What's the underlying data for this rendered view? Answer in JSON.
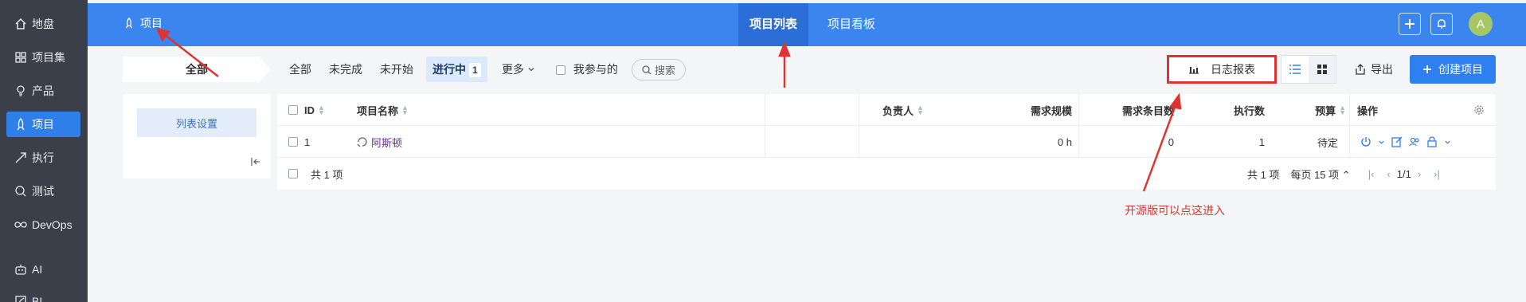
{
  "sidebar": {
    "items": [
      {
        "label": "地盘",
        "icon": "home-icon"
      },
      {
        "label": "项目集",
        "icon": "grid-icon"
      },
      {
        "label": "产品",
        "icon": "lightbulb-icon"
      },
      {
        "label": "项目",
        "icon": "rocket-icon",
        "active": true
      },
      {
        "label": "执行",
        "icon": "paper-plane-icon"
      },
      {
        "label": "测试",
        "icon": "magnifier-icon"
      },
      {
        "label": "DevOps",
        "icon": "infinity-icon"
      },
      {
        "label": "AI",
        "icon": "robot-icon"
      },
      {
        "label": "BI",
        "icon": "chart-icon"
      }
    ]
  },
  "topbar": {
    "brand": "项目",
    "tabs": [
      "项目列表",
      "项目看板"
    ],
    "active_tab": "项目列表",
    "avatar_letter": "A"
  },
  "filter": {
    "all_label": "全部",
    "tabs": [
      "全部",
      "未完成",
      "未开始",
      "进行中",
      "更多"
    ],
    "active_tab": "进行中",
    "active_count": "1",
    "mine_label": "我参与的",
    "search_label": "搜索"
  },
  "toolbar": {
    "report_label": "日志报表",
    "export_label": "导出",
    "create_label": "创建项目"
  },
  "leftpanel": {
    "list_settings": "列表设置"
  },
  "table": {
    "headers": {
      "id": "ID",
      "name": "项目名称",
      "owner": "负责人",
      "scale": "需求规模",
      "story_count": "需求条目数",
      "exec_count": "执行数",
      "budget": "预算",
      "actions": "操作"
    },
    "rows": [
      {
        "id": "1",
        "name": "阿斯顿",
        "owner": "",
        "scale": "0 h",
        "story_count": "0",
        "exec_count": "1",
        "budget": "待定"
      }
    ],
    "footer_total": "共 1 项",
    "pager_total": "共 1 项",
    "pager_per_page": "每页 15 项",
    "pager_page": "1/1"
  },
  "annotation": {
    "note": "开源版可以点这进入"
  },
  "colors": {
    "accent": "#3a85ee",
    "sidebar_bg": "#3b3f4a",
    "annotation_red": "#e0332f",
    "project_link": "#6b2fa3"
  }
}
